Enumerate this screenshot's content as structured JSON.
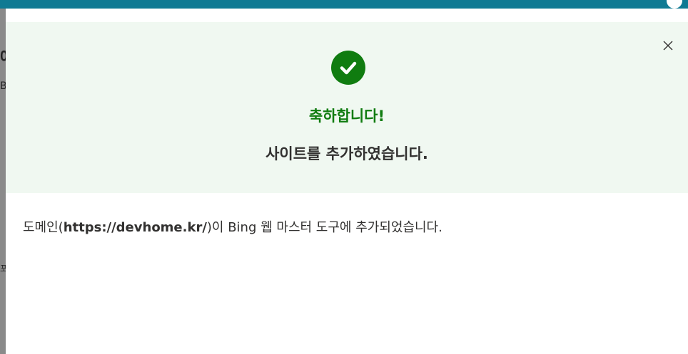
{
  "background": {
    "header_color": "#0f7a93",
    "partial_glyphs": [
      "에",
      "B",
      "포"
    ]
  },
  "dialog": {
    "success_title": "축하합니다!",
    "success_subtitle": "사이트를 추가하였습니다.",
    "message_prefix": "도메인(",
    "domain": "https://devhome.kr/",
    "message_suffix": ")이 Bing 웹 마스터 도구에 추가되었습니다.",
    "icons": {
      "success": "check-circle-icon",
      "close": "close-icon"
    },
    "colors": {
      "success": "#107c10",
      "panel": "#f0f8f1",
      "text": "#323130"
    }
  }
}
